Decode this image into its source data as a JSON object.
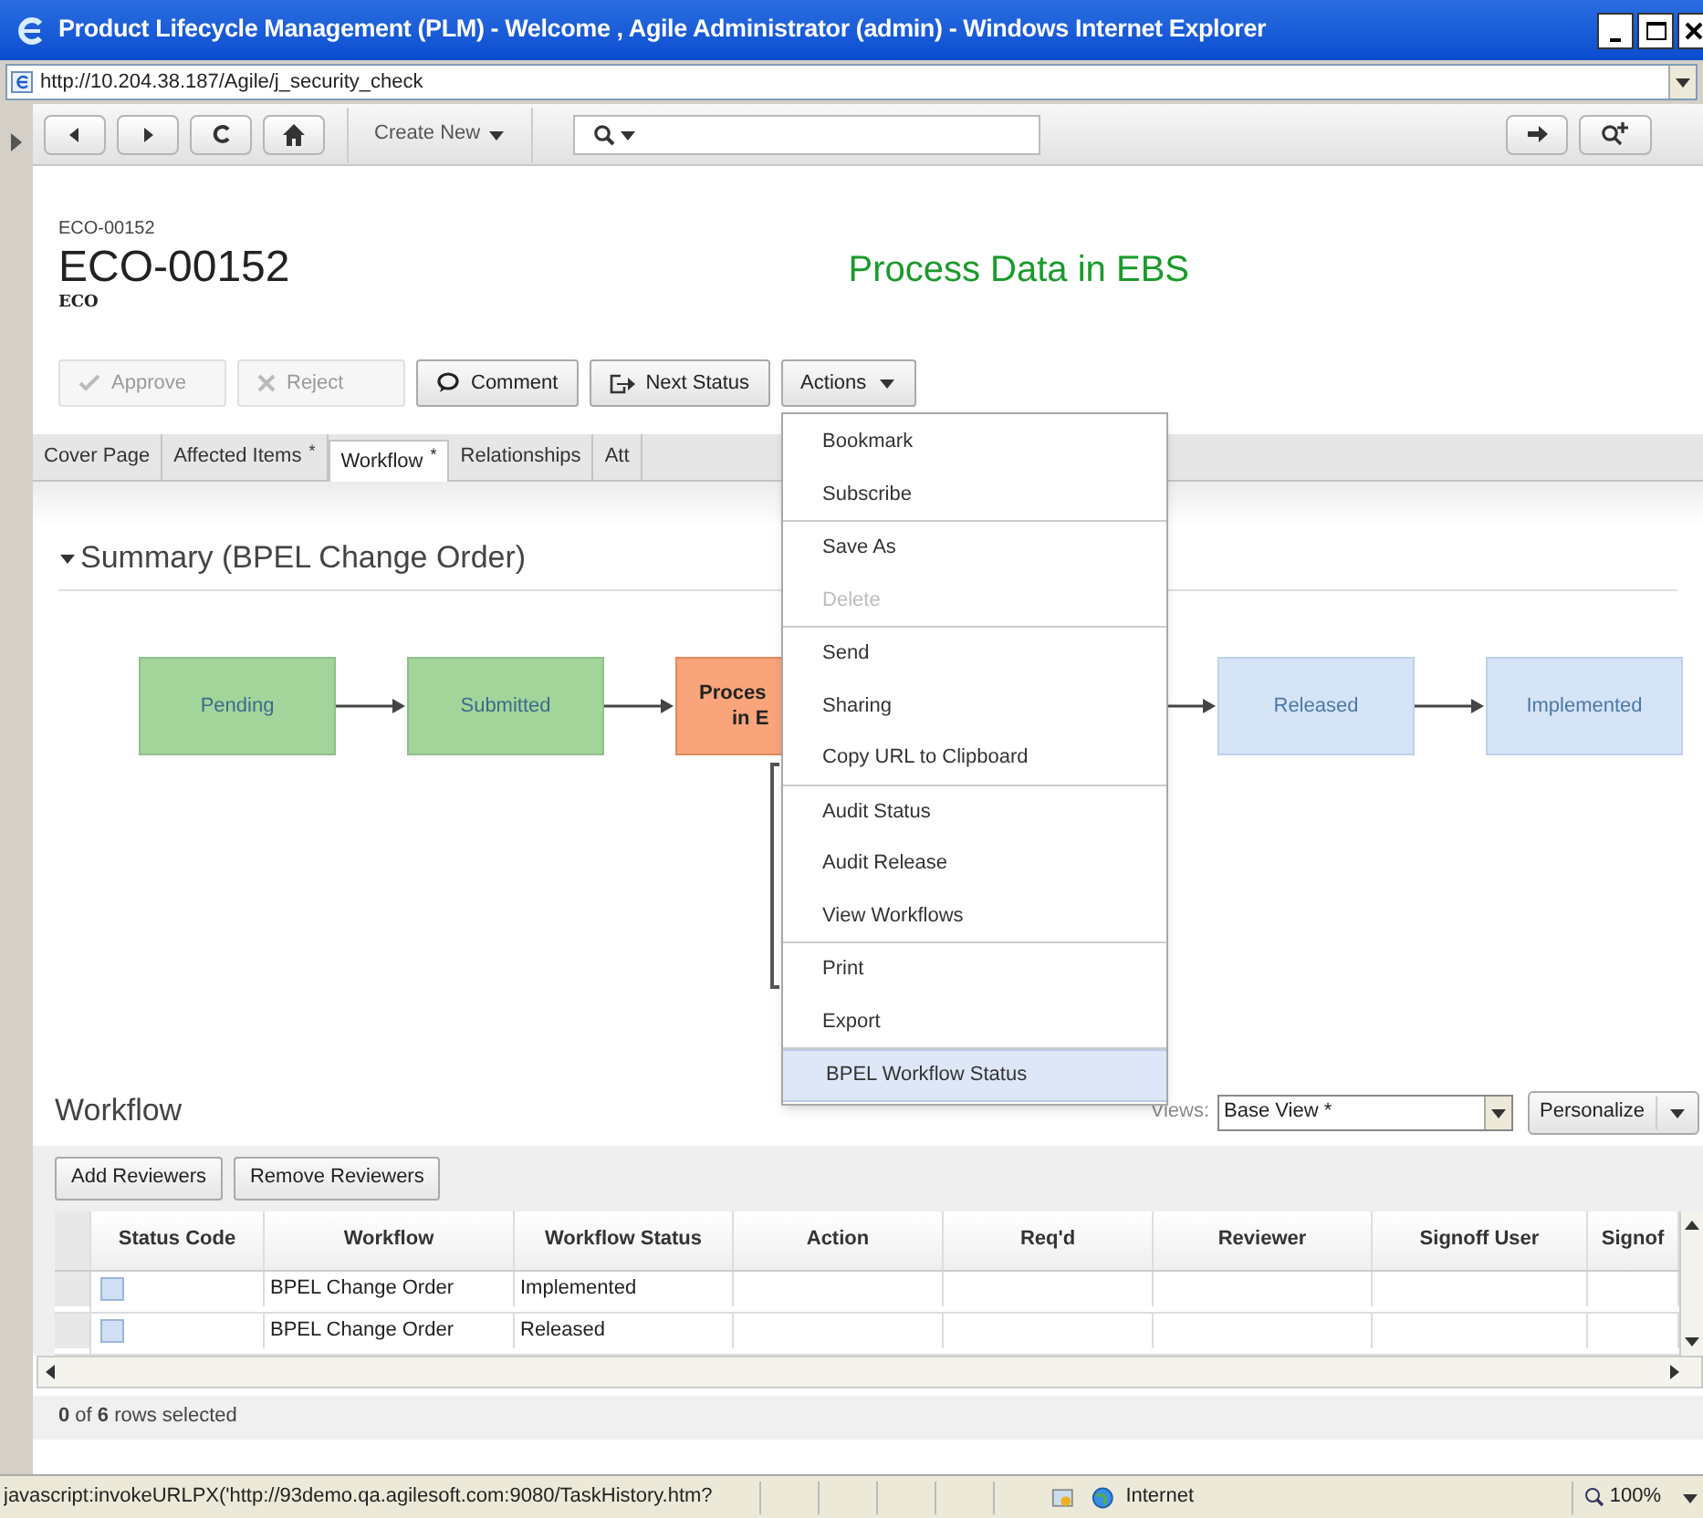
{
  "window": {
    "title": "Product Lifecycle Management (PLM) - Welcome , Agile Administrator (admin) - Windows Internet Explorer"
  },
  "address": "http://10.204.38.187/Agile/j_security_check",
  "toolbar": {
    "create_new": "Create New"
  },
  "object": {
    "id_small": "ECO-00152",
    "id": "ECO-00152",
    "type": "ECO",
    "banner": "Process Data in EBS"
  },
  "actions": [
    {
      "kind": "approve",
      "label": "Approve",
      "disabled": true
    },
    {
      "kind": "reject",
      "label": "Reject",
      "disabled": true
    },
    {
      "kind": "comment",
      "label": "Comment",
      "disabled": false
    },
    {
      "kind": "next",
      "label": "Next Status",
      "disabled": false
    },
    {
      "kind": "menu",
      "label": "Actions",
      "disabled": false
    }
  ],
  "tabs": [
    {
      "label": "Cover Page",
      "selected": false
    },
    {
      "label": "Affected Items",
      "mark": "*",
      "selected": false
    },
    {
      "label": "Workflow",
      "mark": "*",
      "selected": true
    },
    {
      "label": "Relationships",
      "selected": false
    },
    {
      "label": "Att",
      "selected": false
    }
  ],
  "actions_menu": [
    [
      {
        "label": "Bookmark",
        "disabled": false,
        "selected": false
      },
      {
        "label": "Subscribe",
        "disabled": false,
        "selected": false
      }
    ],
    [
      {
        "label": "Save As",
        "disabled": false,
        "selected": false
      },
      {
        "label": "Delete",
        "disabled": true,
        "selected": false
      }
    ],
    [
      {
        "label": "Send",
        "disabled": false,
        "selected": false
      },
      {
        "label": "Sharing",
        "disabled": false,
        "selected": false
      },
      {
        "label": "Copy URL to Clipboard",
        "disabled": false,
        "selected": false
      }
    ],
    [
      {
        "label": "Audit Status",
        "disabled": false,
        "selected": false
      },
      {
        "label": "Audit Release",
        "disabled": false,
        "selected": false
      },
      {
        "label": "View Workflows",
        "disabled": false,
        "selected": false
      }
    ],
    [
      {
        "label": "Print",
        "disabled": false,
        "selected": false
      },
      {
        "label": "Export",
        "disabled": false,
        "selected": false
      }
    ],
    [
      {
        "label": "BPEL Workflow Status",
        "disabled": false,
        "selected": true
      }
    ]
  ],
  "summary": {
    "title": "Summary  (BPEL Change Order)",
    "expanded": true,
    "nodes": [
      {
        "kind": "done",
        "lines": [
          "Pending"
        ]
      },
      {
        "kind": "done",
        "lines": [
          "Submitted"
        ]
      },
      {
        "kind": "current",
        "lines": [
          "Proces",
          "in E"
        ]
      },
      {
        "kind": "future",
        "lines": [
          "Released"
        ]
      },
      {
        "kind": "future",
        "lines": [
          "Implemented"
        ]
      }
    ]
  },
  "workflow": {
    "title": "Workflow",
    "views_label": "Views:",
    "view": "Base View *",
    "personalize": "Personalize",
    "buttons": [
      "Add Reviewers",
      "Remove Reviewers"
    ],
    "columns": [
      "Status Code",
      "Workflow",
      "Workflow Status",
      "Action",
      "Req'd",
      "Reviewer",
      "Signoff User",
      "Signof"
    ],
    "rows": [
      {
        "color": "#cfe0f5",
        "workflow": "BPEL Change Order",
        "status": "Implemented"
      },
      {
        "color": "#cfe0f5",
        "workflow": "BPEL Change Order",
        "status": "Released"
      }
    ],
    "selection": "**0** of **6** rows selected"
  },
  "status_bar": {
    "text": "javascript:invokeURLPX('http://93demo.qa.agilesoft.com:9080/TaskHistory.htm?",
    "zone": "Internet",
    "zoom": "100%"
  }
}
